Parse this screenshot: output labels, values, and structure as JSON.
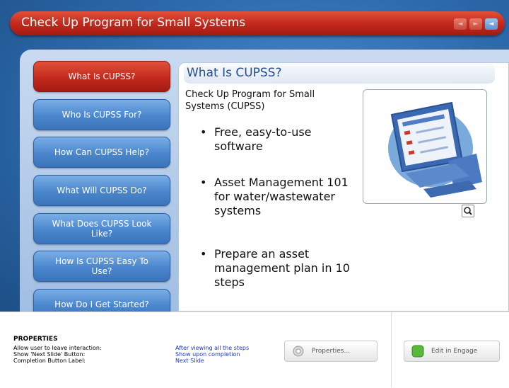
{
  "title": "Check Up Program for Small Systems",
  "nav_buttons": [
    "◄",
    "►",
    "◄"
  ],
  "menu": [
    {
      "label": "What Is CUPSS?",
      "active": true
    },
    {
      "label": "Who Is CUPSS For?"
    },
    {
      "label": "How Can CUPSS Help?"
    },
    {
      "label": "What Will CUPSS Do?"
    },
    {
      "label": "What Does CUPSS Look Like?"
    },
    {
      "label": "How Is CUPSS Easy To Use?"
    },
    {
      "label": "How Do I Get Started?"
    }
  ],
  "content": {
    "heading": "What Is CUPSS?",
    "intro": "Check Up Program for Small Systems (CUPSS)",
    "bullets": [
      "Free, easy-to-use software",
      "Asset Management 101 for water/wastewater systems",
      "Prepare an asset management plan in 10 steps"
    ]
  },
  "properties": {
    "heading": "PROPERTIES",
    "rows": [
      {
        "label": "Allow user to leave interaction:",
        "value": "After viewing all the steps"
      },
      {
        "label": "Show 'Next Slide' Button:",
        "value": "Show upon completion"
      },
      {
        "label": "Completion Button Label:",
        "value": "Next Slide"
      }
    ],
    "properties_button": "Properties...",
    "engage_button": "Edit in Engage"
  },
  "colors": {
    "accent_red": "#c42a1d",
    "blue": "#2c69ab",
    "link_blue": "#1a37d6"
  }
}
